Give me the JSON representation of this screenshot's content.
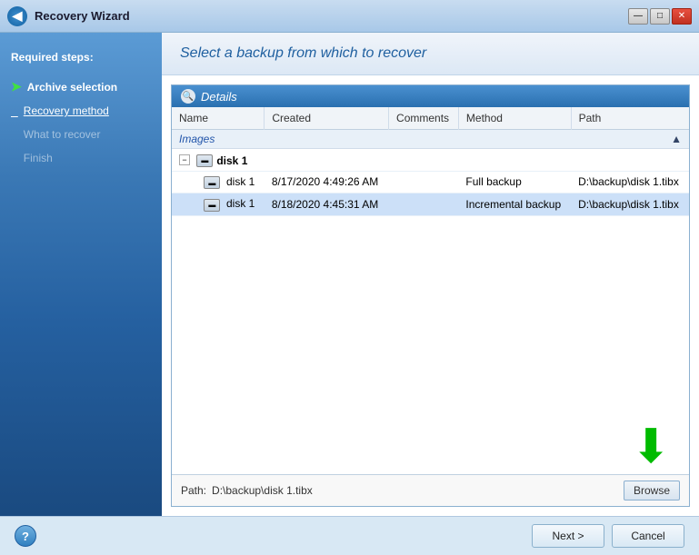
{
  "titleBar": {
    "title": "Recovery Wizard",
    "minimizeLabel": "—",
    "maximizeLabel": "□",
    "closeLabel": "✕"
  },
  "sidebar": {
    "sectionTitle": "Required steps:",
    "items": [
      {
        "id": "archive-selection",
        "label": "Archive selection",
        "state": "active",
        "icon": "➤"
      },
      {
        "id": "recovery-method",
        "label": "Recovery method",
        "state": "underline",
        "icon": ""
      },
      {
        "id": "what-to-recover",
        "label": "What to recover",
        "state": "disabled",
        "icon": ""
      },
      {
        "id": "finish",
        "label": "Finish",
        "state": "disabled",
        "icon": ""
      }
    ]
  },
  "contentHeader": {
    "title": "Select a backup from which to recover"
  },
  "detailsPanel": {
    "title": "Details",
    "columns": [
      {
        "id": "name",
        "label": "Name"
      },
      {
        "id": "created",
        "label": "Created"
      },
      {
        "id": "comments",
        "label": "Comments"
      },
      {
        "id": "method",
        "label": "Method"
      },
      {
        "id": "path",
        "label": "Path"
      }
    ],
    "groups": [
      {
        "label": "Images",
        "collapsed": false,
        "parent": {
          "name": "disk 1",
          "type": "disk"
        },
        "items": [
          {
            "name": "disk 1",
            "created": "8/17/2020 4:49:26 AM",
            "comments": "",
            "method": "Full backup",
            "path": "D:\\backup\\disk 1.tibx",
            "selected": false
          },
          {
            "name": "disk 1",
            "created": "8/18/2020 4:45:31 AM",
            "comments": "",
            "method": "Incremental backup",
            "path": "D:\\backup\\disk 1.tibx",
            "selected": true
          }
        ]
      }
    ]
  },
  "pathBar": {
    "label": "Path:",
    "value": "D:\\backup\\disk 1.tibx",
    "browseLabel": "Browse"
  },
  "footer": {
    "helpIcon": "?",
    "nextLabel": "Next >",
    "cancelLabel": "Cancel"
  }
}
